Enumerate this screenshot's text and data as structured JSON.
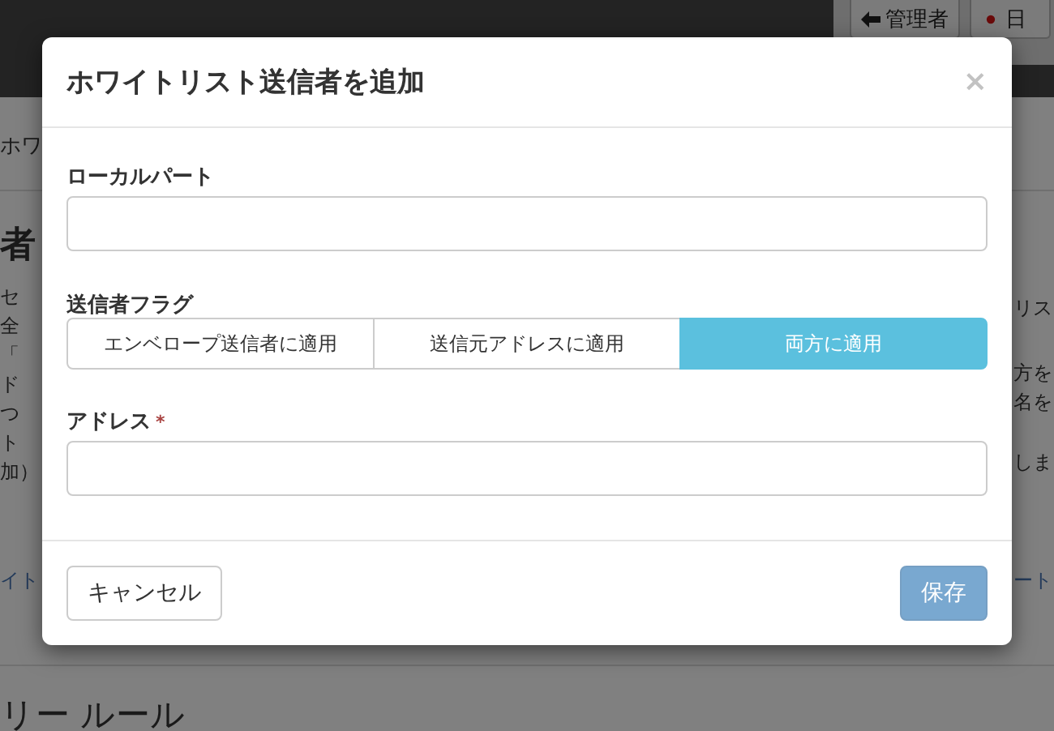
{
  "header": {
    "buttons": [
      {
        "kind": "back",
        "label": "管理者"
      },
      {
        "kind": "language",
        "label": "日"
      }
    ]
  },
  "page": {
    "breadcrumb": "ホワ",
    "heading": "者",
    "left_lines": [
      "セ",
      "全",
      "「",
      "ド",
      "つ",
      "ト",
      "加）"
    ],
    "left_link": "イト",
    "right_paragraphs": [
      [
        "リス"
      ],
      [
        "方を",
        "名を"
      ],
      [
        "しま"
      ]
    ],
    "right_link": "ート",
    "section_heading": "リー ルール"
  },
  "dialog": {
    "title": "ホワイトリスト送信者を追加",
    "close": "×",
    "fields": [
      {
        "kind": "text",
        "label": "ローカルパート"
      },
      {
        "kind": "segmented",
        "label": "送信者フラグ",
        "options": [
          {
            "label": "エンベロープ送信者に適用",
            "selected": false
          },
          {
            "label": "送信元アドレスに適用",
            "selected": false
          },
          {
            "label": "両方に適用",
            "selected": true
          }
        ]
      },
      {
        "kind": "text",
        "label": "アドレス",
        "required_mark": "*"
      }
    ],
    "buttons": [
      {
        "kind": "default",
        "label": "キャンセル",
        "disabled": false
      },
      {
        "kind": "primary",
        "label": "保存",
        "disabled": true
      }
    ]
  }
}
